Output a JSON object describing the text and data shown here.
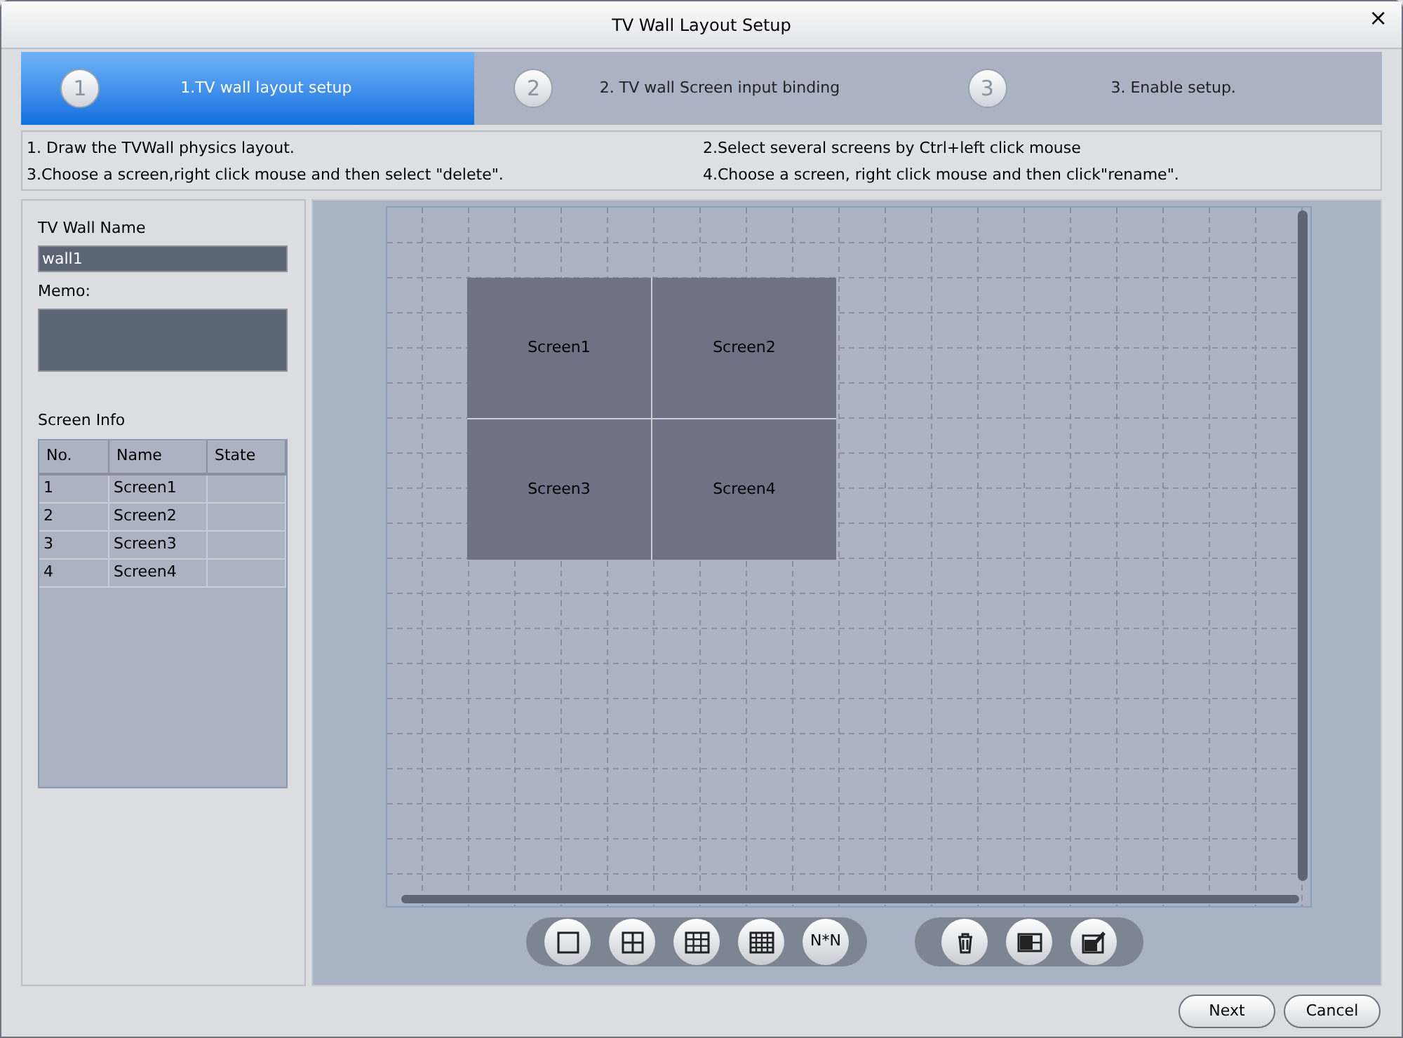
{
  "window": {
    "title": "TV Wall Layout Setup",
    "close": "×"
  },
  "steps": [
    {
      "number": "1",
      "label": "1.TV wall layout setup",
      "selected": true
    },
    {
      "number": "2",
      "label": "2. TV wall Screen input binding",
      "selected": false
    },
    {
      "number": "3",
      "label": "3. Enable setup.",
      "selected": false
    }
  ],
  "instructions": [
    "1. Draw the TVWall physics layout.",
    "2.Select several screens by Ctrl+left click mouse",
    "3.Choose a screen,right click mouse and then select \"delete\".",
    "4.Choose a screen, right click mouse and then click\"rename\"."
  ],
  "form": {
    "name_label": "TV Wall Name",
    "name_value": "wall1",
    "memo_label": "Memo:"
  },
  "screen_info": {
    "title": "Screen Info",
    "columns": [
      "No.",
      "Name",
      "State"
    ],
    "rows": [
      [
        "1",
        "Screen1",
        ""
      ],
      [
        "2",
        "Screen2",
        ""
      ],
      [
        "3",
        "Screen3",
        ""
      ],
      [
        "4",
        "Screen4",
        ""
      ]
    ]
  },
  "canvas": {
    "screens": [
      "Screen1",
      "Screen2",
      "Screen3",
      "Screen4"
    ]
  },
  "toolbar": [
    {
      "kind": "split1"
    },
    {
      "kind": "split4"
    },
    {
      "kind": "split9"
    },
    {
      "kind": "split16"
    },
    {
      "kind": "nxn",
      "label": "N*N"
    }
  ],
  "toolbar2": [
    {
      "kind": "delete"
    },
    {
      "kind": "merge"
    },
    {
      "kind": "edit"
    }
  ],
  "buttons": [
    "Next",
    "Cancel"
  ]
}
